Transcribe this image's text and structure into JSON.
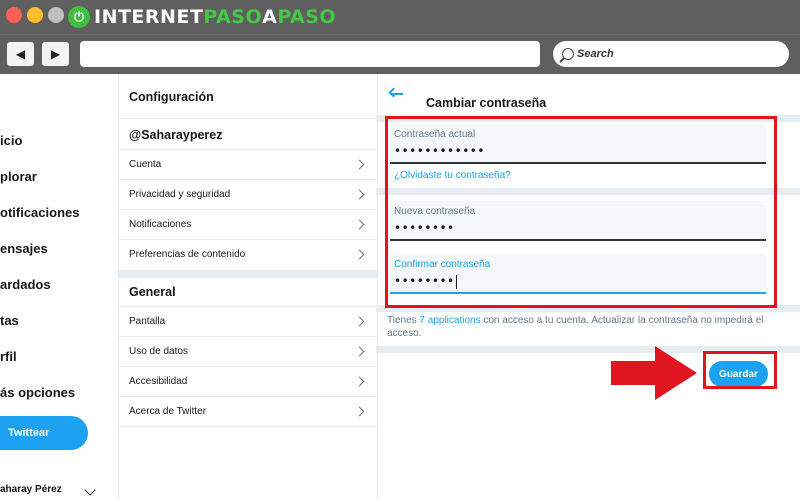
{
  "browser": {
    "logo_part1": "INTERNET",
    "logo_part2": "PASO",
    "logo_part3": "A",
    "logo_part4": "PASO",
    "search_placeholder": "Search",
    "back_glyph": "◀",
    "forward_glyph": "▶",
    "colors": {
      "close": "#ff5f57",
      "minimize": "#ffbd2e",
      "maximize": "#bfbfbf"
    }
  },
  "left_nav": {
    "items": [
      "icio",
      "plorar",
      "otificaciones",
      "ensajes",
      "ardados",
      "tas",
      "rfil",
      "ás opciones"
    ],
    "tweet_button": "Twittear",
    "profile_name": "aharay Pérez"
  },
  "settings": {
    "title": "Configuración",
    "username": "@Saharayperez",
    "account_items": [
      "Cuenta",
      "Privacidad y seguridad",
      "Notificaciones",
      "Preferencias de contenido"
    ],
    "general_title": "General",
    "general_items": [
      "Pantalla",
      "Uso de datos",
      "Accesibilidad",
      "Acerca de Twitter"
    ]
  },
  "change_password": {
    "title": "Cambiar contraseña",
    "current_label": "Contraseña actual",
    "current_value": "••••••••••••",
    "forgot_link": "¿Olvidaste tu contraseña?",
    "new_label": "Nueva contraseña",
    "new_value": "••••••••",
    "confirm_label": "Confirmar contraseña",
    "confirm_value": "••••••••",
    "info_prefix": "Tienes ",
    "info_link": "7 applications",
    "info_suffix": " con acceso a tu cuenta. Actualizar la contraseña no impedirá el acceso.",
    "save_button": "Guardar"
  },
  "accent_color": "#1da1f2",
  "annotation_color": "#e0151f"
}
